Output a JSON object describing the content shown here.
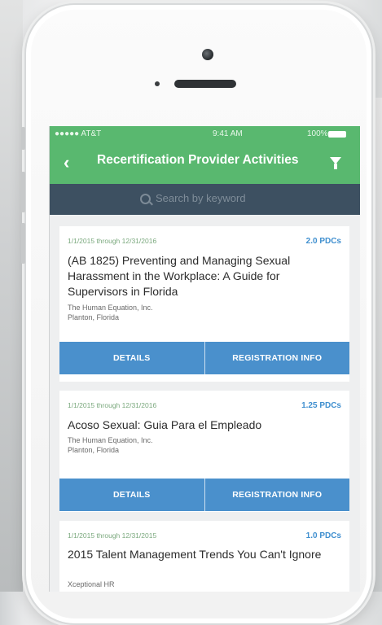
{
  "status_bar": {
    "carrier": "●●●●● AT&T",
    "time": "9:41 AM",
    "battery": "100%"
  },
  "header": {
    "title": "Recertification Provider Activities"
  },
  "search": {
    "placeholder": "Search by keyword"
  },
  "activities": [
    {
      "dates": "1/1/2015 through 12/31/2016",
      "pdcs": "2.0 PDCs",
      "title": "(AB 1825) Preventing and Managing Sexual Harassment in the Workplace:  A Guide for Supervisors in Florida",
      "provider": "The Human Equation, Inc.",
      "location": "Planton, Florida",
      "details_label": "DETAILS",
      "registration_label": "REGISTRATION INFO"
    },
    {
      "dates": "1/1/2015 through 12/31/2016",
      "pdcs": "1.25 PDCs",
      "title": "Acoso Sexual:  Guia Para el Empleado",
      "provider": "The Human Equation, Inc.",
      "location": "Planton, Florida",
      "details_label": "DETAILS",
      "registration_label": "REGISTRATION INFO"
    },
    {
      "dates": "1/1/2015 through 12/31/2015",
      "pdcs": "1.0 PDCs",
      "title": "2015 Talent Management Trends You Can't Ignore",
      "provider": "Xceptional HR"
    }
  ],
  "icons": [
    "back-chevron-icon",
    "filter-icon",
    "search-icon",
    "wifi-icon",
    "battery-icon",
    "camera-icon",
    "speaker-icon"
  ],
  "colors": {
    "header_green": "#59b86f",
    "search_bar": "#3d5061",
    "action_blue": "#4a90cc",
    "pdc_blue": "#3f8fcf",
    "date_green": "#7ba97e"
  }
}
